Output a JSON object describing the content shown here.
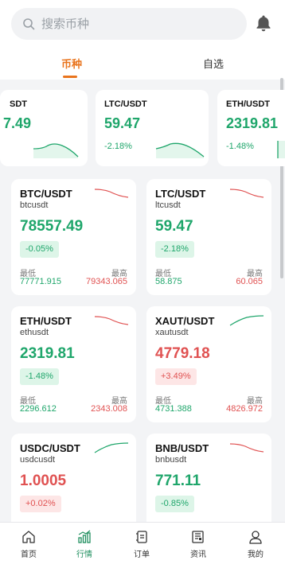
{
  "search": {
    "placeholder": "搜索币种"
  },
  "tabs": [
    {
      "label": "币种",
      "active": true
    },
    {
      "label": "自选",
      "active": false
    }
  ],
  "tickers": [
    {
      "symbol": "SDT",
      "price": "7.49",
      "change": ""
    },
    {
      "symbol": "LTC/USDT",
      "price": "59.47",
      "change": "-2.18%"
    },
    {
      "symbol": "ETH/USDT",
      "price": "2319.81",
      "change": "-1.48%"
    }
  ],
  "labels": {
    "low": "最低",
    "high": "最高"
  },
  "cards": [
    {
      "symbol": "BTC/USDT",
      "sub": "btcusdt",
      "price": "78557.49",
      "change": "-0.05%",
      "low": "77771.915",
      "high": "79343.065",
      "trend": "down"
    },
    {
      "symbol": "LTC/USDT",
      "sub": "ltcusdt",
      "price": "59.47",
      "change": "-2.18%",
      "low": "58.875",
      "high": "60.065",
      "trend": "down"
    },
    {
      "symbol": "ETH/USDT",
      "sub": "ethusdt",
      "price": "2319.81",
      "change": "-1.48%",
      "low": "2296.612",
      "high": "2343.008",
      "trend": "down"
    },
    {
      "symbol": "XAUT/USDT",
      "sub": "xautusdt",
      "price": "4779.18",
      "change": "+3.49%",
      "low": "4731.388",
      "high": "4826.972",
      "trend": "up"
    },
    {
      "symbol": "USDC/USDT",
      "sub": "usdcusdt",
      "price": "1.0005",
      "change": "+0.02%",
      "low": "",
      "high": "",
      "trend": "up"
    },
    {
      "symbol": "BNB/USDT",
      "sub": "bnbusdt",
      "price": "771.11",
      "change": "-0.85%",
      "low": "",
      "high": "",
      "trend": "down"
    }
  ],
  "nav": [
    {
      "label": "首页",
      "icon": "home-icon"
    },
    {
      "label": "行情",
      "icon": "market-chart-icon",
      "active": true
    },
    {
      "label": "订单",
      "icon": "order-icon"
    },
    {
      "label": "资讯",
      "icon": "news-icon"
    },
    {
      "label": "我的",
      "icon": "profile-icon"
    }
  ],
  "colors": {
    "accent": "#e9741d",
    "green": "#1fa66b",
    "red": "#e05252"
  }
}
